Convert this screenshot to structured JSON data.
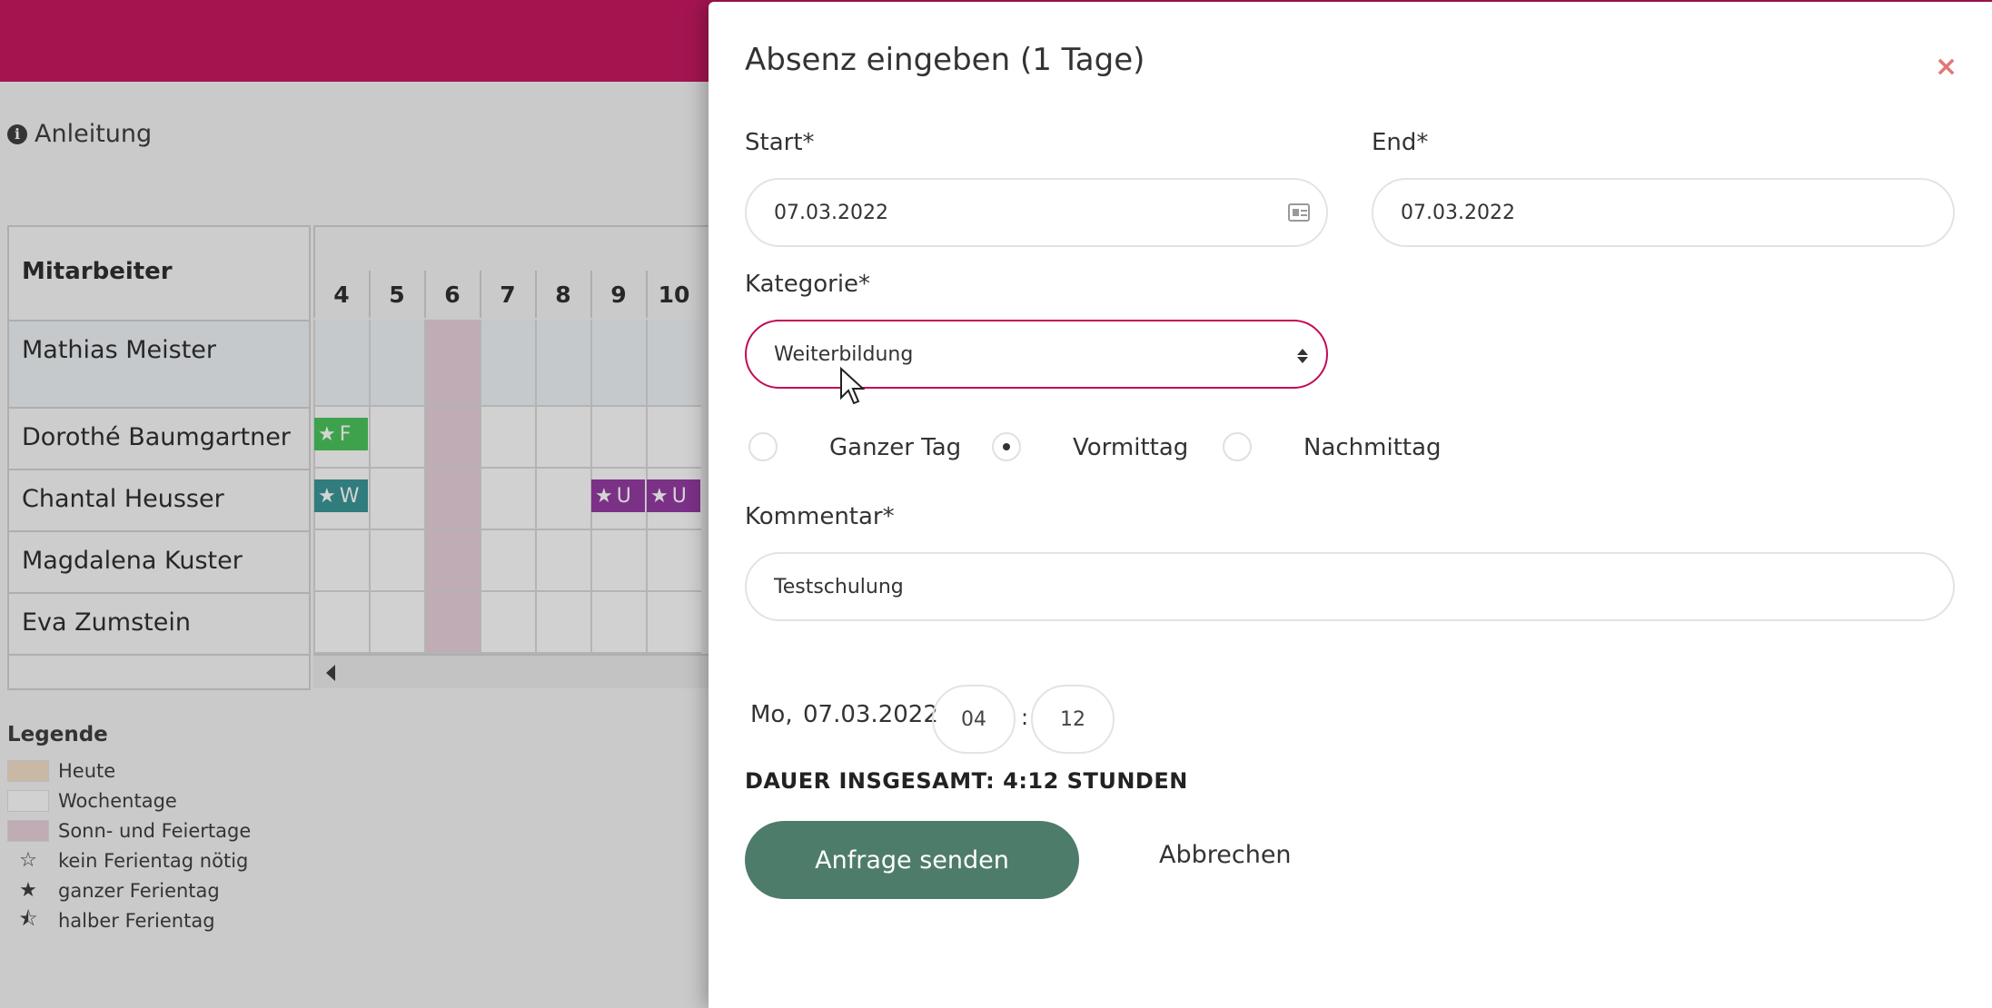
{
  "background": {
    "help_link": "Anleitung",
    "table": {
      "header_label": "Mitarbeiter",
      "days": [
        "4",
        "5",
        "6",
        "7",
        "8",
        "9",
        "10"
      ],
      "employees": [
        "Mathias Meister",
        "Dorothé Baumgartner",
        "Chantal Heusser",
        "Magdalena Kuster",
        "Eva Zumstein"
      ],
      "absences": [
        {
          "row": 1,
          "day_index": 0,
          "letter": "F",
          "color": "#3fbf52"
        },
        {
          "row": 2,
          "day_index": 0,
          "letter": "W",
          "color": "#2f8f8f"
        },
        {
          "row": 2,
          "day_index": 5,
          "letter": "U",
          "color": "#8e2f9c"
        },
        {
          "row": 2,
          "day_index": 6,
          "letter": "U",
          "color": "#8e2f9c"
        }
      ]
    },
    "legend": {
      "title": "Legende",
      "items": [
        {
          "label": "Heute",
          "kind": "swatch",
          "color": "#f1dcc0"
        },
        {
          "label": "Wochentage",
          "kind": "swatch",
          "color": "#fbfbfb"
        },
        {
          "label": "Sonn- und Feiertage",
          "kind": "swatch",
          "color": "#e6ccd6"
        },
        {
          "label": "kein Ferientag nötig",
          "kind": "star",
          "glyph": "☆"
        },
        {
          "label": "ganzer Ferientag",
          "kind": "star",
          "glyph": "★"
        },
        {
          "label": "halber Ferientag",
          "kind": "star",
          "glyph": "⯪"
        }
      ]
    },
    "brand_color": "#c20b56"
  },
  "modal": {
    "title": "Absenz eingeben (1 Tage)",
    "close_label": "×",
    "start_label": "Start*",
    "start_value": "07.03.2022",
    "end_label": "End*",
    "end_value": "07.03.2022",
    "category_label": "Kategorie*",
    "category_value": "Weiterbildung",
    "radios": [
      {
        "label": "Ganzer Tag",
        "checked": false
      },
      {
        "label": "Vormittag",
        "checked": true
      },
      {
        "label": "Nachmittag",
        "checked": false
      }
    ],
    "comment_label": "Kommentar*",
    "comment_value": "Testschulung",
    "day_prefix": "Mo,",
    "date": "07.03.2022",
    "hours": "04",
    "minutes": "12",
    "time_separator": ":",
    "duration": "DAUER INSGESAMT: 4:12 STUNDEN",
    "submit_label": "Anfrage senden",
    "cancel_label": "Abbrechen",
    "accent_color": "#4e7c6a"
  }
}
